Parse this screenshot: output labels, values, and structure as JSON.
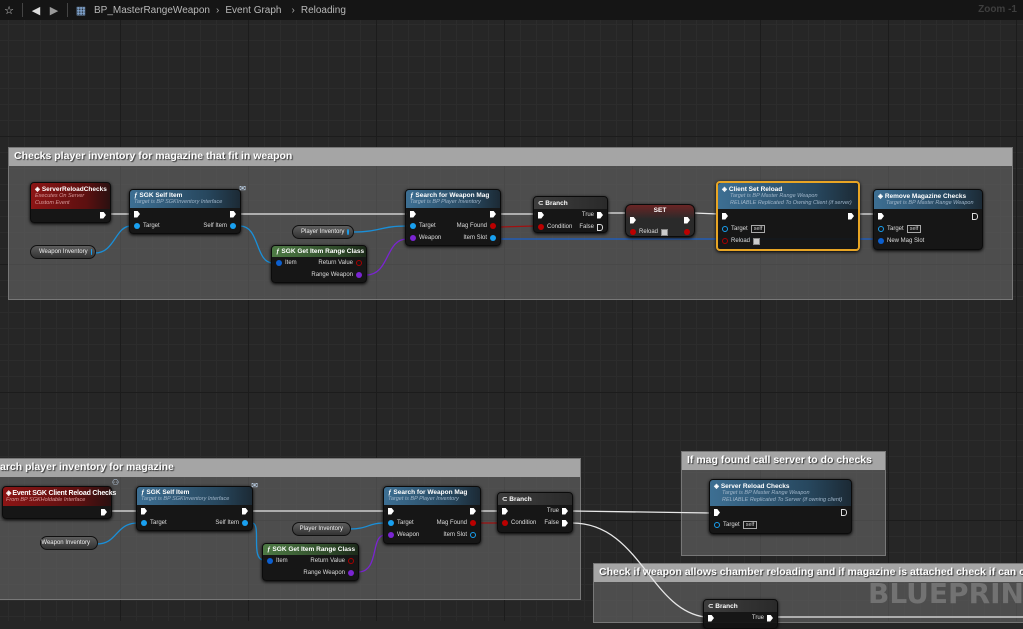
{
  "toolbar": {
    "breadcrumb": [
      "BP_MasterRangeWeapon",
      "Event Graph",
      "Reloading"
    ],
    "zoom": "Zoom -1",
    "icons": [
      "star-icon",
      "back-arrow-icon",
      "forward-arrow-icon",
      "blueprint-icon"
    ]
  },
  "comments": [
    {
      "title": "Checks player inventory for magazine that fit in weapon"
    },
    {
      "title": "arch player inventory for magazine"
    },
    {
      "title": "If mag found call server to do checks"
    },
    {
      "title": "Check if weapon allows chamber reloading and if magazine is attached check if can cha"
    }
  ],
  "watermark": "BLUEPRINT",
  "g1": {
    "event": {
      "title": "ServerReloadChecks",
      "sub1": "Executes On Server",
      "sub2": "Custom Event"
    },
    "selfitem": {
      "title": "SGK Self Item",
      "sub": "Target is BP SGKInventory Interface",
      "target": "Target",
      "out": "Self Item"
    },
    "weaponinv": "Weapon Inventory",
    "playerinv": "Player Inventory",
    "range": {
      "title": "SGK Get Item Range Class",
      "item": "Item",
      "ret": "Return Value",
      "rw": "Range Weapon"
    },
    "search": {
      "title": "Search for Weapon Mag",
      "sub": "Target is BP Player Inventory",
      "target": "Target",
      "weapon": "Weapon",
      "found": "Mag Found",
      "slot": "Item Slot"
    },
    "branch": {
      "title": "Branch",
      "cond": "Condition",
      "t": "True",
      "f": "False"
    },
    "set": {
      "title": "SET",
      "reload": "Reload"
    },
    "client": {
      "title": "Client Set Reload",
      "sub1": "Target is BP Master Range Weapon",
      "sub2": "RELIABLE Replicated To Owning Client (if server)",
      "target": "Target",
      "self": "self",
      "reload": "Reload"
    },
    "remove": {
      "title": "Remove Magazine Checks",
      "sub": "Target is BP Master Range Weapon",
      "target": "Target",
      "self": "self",
      "slot": "New Mag Slot"
    }
  },
  "g2": {
    "event": {
      "title": "Event SGK Client Reload Checks",
      "sub": "From BP SGKHoldable Interface"
    },
    "selfitem": {
      "title": "SGK Self Item",
      "sub": "Target is BP SGKInventory Interface",
      "target": "Target",
      "out": "Self Item"
    },
    "weaponinv": "Weapon Inventory",
    "playerinv": "Player Inventory",
    "range": {
      "title": "SGK Get Item Range Class",
      "item": "Item",
      "ret": "Return Value",
      "rw": "Range Weapon"
    },
    "search": {
      "title": "Search for Weapon Mag",
      "sub": "Target is BP Player Inventory",
      "target": "Target",
      "weapon": "Weapon",
      "found": "Mag Found",
      "slot": "Item Slot"
    },
    "branch": {
      "title": "Branch",
      "cond": "Condition",
      "t": "True",
      "f": "False"
    }
  },
  "g3": {
    "server": {
      "title": "Server Reload Checks",
      "sub1": "Target is BP Master Range Weapon",
      "sub2": "RELIABLE Replicated To Server (if owning client)",
      "target": "Target",
      "self": "self"
    }
  },
  "g4": {
    "branch": {
      "title": "Branch",
      "t": "True"
    }
  }
}
